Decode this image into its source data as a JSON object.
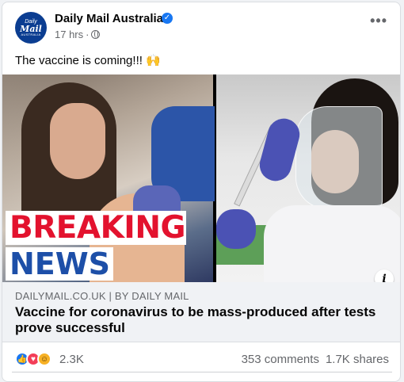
{
  "post": {
    "page_name": "Daily Mail Australia",
    "avatar": {
      "line1": "Daily",
      "line2": "Mail",
      "line3": "AUSTRALIA"
    },
    "time": "17 hrs",
    "dot": "·",
    "text": "The vaccine is coming!!! 🙌",
    "image_overlay": {
      "breaking": "BREAKING",
      "news": "NEWS"
    },
    "link": {
      "domain": "DAILYMAIL.CO.UK | BY DAILY MAIL",
      "title": "Vaccine for coronavirus to be mass-produced after tests prove successful"
    },
    "stats": {
      "reactions": "2.3K",
      "comments": "353 comments",
      "shares": "1.7K shares"
    }
  },
  "icons": {
    "verified": "verified-badge-icon",
    "globe": "globe-icon",
    "more": "more-options-icon",
    "info": "info-icon",
    "reactions": [
      "like-icon",
      "love-icon",
      "haha-icon"
    ]
  },
  "colors": {
    "brand_blue": "#1877f2",
    "breaking_red": "#e3122e",
    "news_blue": "#1d4fa8",
    "secondary_text": "#65676b"
  }
}
